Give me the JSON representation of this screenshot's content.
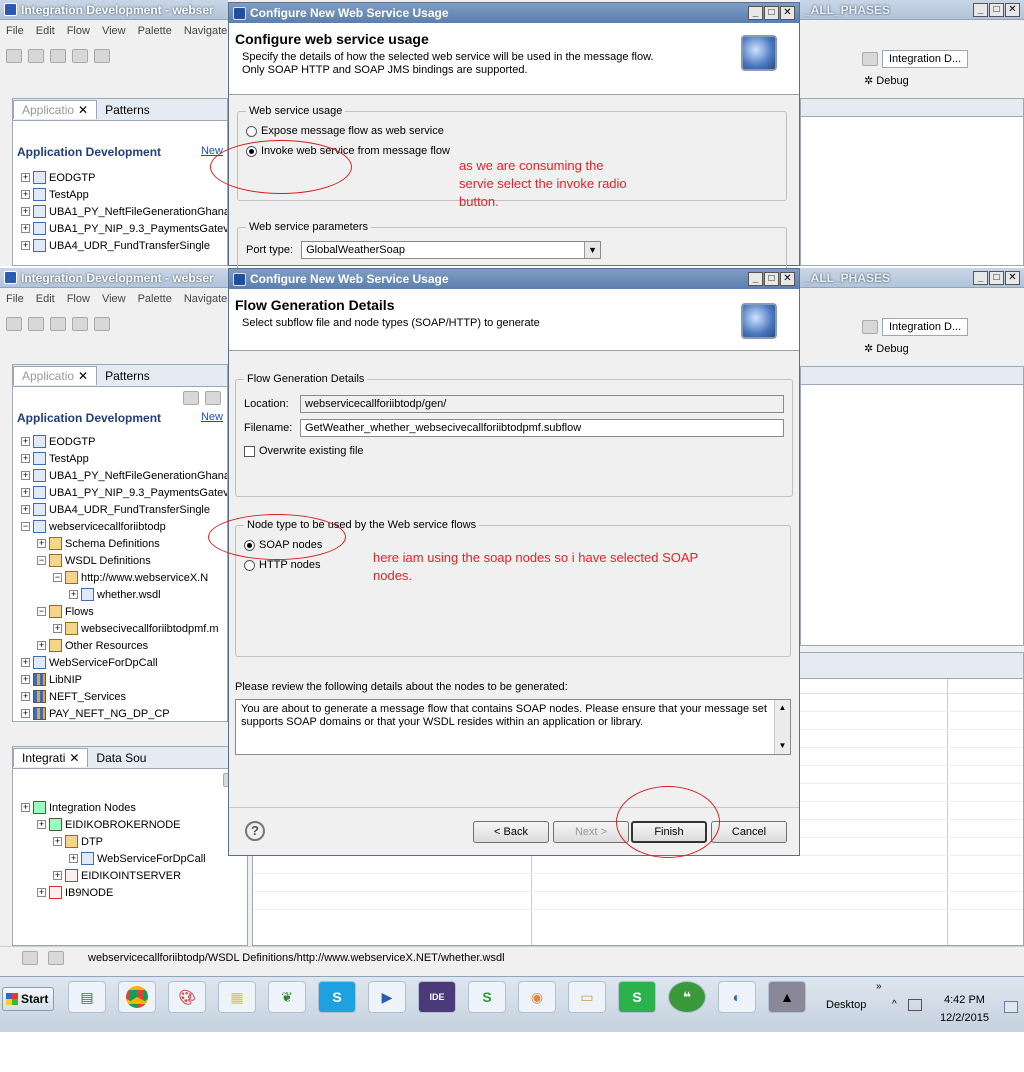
{
  "back_window": {
    "title": "Integration Development - webser",
    "title_right": "_ALL_PHASES",
    "menu": [
      "File",
      "Edit",
      "Flow",
      "View",
      "Palette",
      "Navigate"
    ],
    "tabs": [
      "Applicatio",
      "Patterns"
    ],
    "header": "Application Development",
    "new_link": "New",
    "tree": [
      "EODGTP",
      "TestApp",
      "UBA1_PY_NeftFileGenerationGhana",
      "UBA1_PY_NIP_9.3_PaymentsGatev",
      "UBA4_UDR_FundTransferSingle"
    ],
    "right_panel": {
      "title": "Integration D...",
      "debug": "Debug"
    }
  },
  "front_window": {
    "title": "Integration Development - webser",
    "title_right": "_ALL_PHASES",
    "menu": [
      "File",
      "Edit",
      "Flow",
      "View",
      "Palette",
      "Navigate"
    ],
    "tabs": [
      "Applicatio",
      "Patterns"
    ],
    "header": "Application Development",
    "new_link": "New",
    "tree": [
      {
        "label": "EODGTP",
        "level": 0,
        "icon": "app"
      },
      {
        "label": "TestApp",
        "level": 0,
        "icon": "app"
      },
      {
        "label": "UBA1_PY_NeftFileGenerationGhana",
        "level": 0,
        "icon": "app"
      },
      {
        "label": "UBA1_PY_NIP_9.3_PaymentsGatev",
        "level": 0,
        "icon": "app"
      },
      {
        "label": "UBA4_UDR_FundTransferSingle",
        "level": 0,
        "icon": "app"
      },
      {
        "label": "webservicecallforiibtodp",
        "level": 0,
        "icon": "app",
        "open": true
      },
      {
        "label": "Schema Definitions",
        "level": 1,
        "icon": "res"
      },
      {
        "label": "WSDL Definitions",
        "level": 1,
        "icon": "res",
        "open": true
      },
      {
        "label": "http://www.webserviceX.N",
        "level": 2,
        "icon": "res",
        "open": true
      },
      {
        "label": "whether.wsdl",
        "level": 3,
        "icon": "app"
      },
      {
        "label": "Flows",
        "level": 1,
        "icon": "res",
        "open": true
      },
      {
        "label": "websecivecallforiibtodpmf.m",
        "level": 2,
        "icon": "res"
      },
      {
        "label": "Other Resources",
        "level": 1,
        "icon": "res"
      },
      {
        "label": "WebServiceForDpCall",
        "level": 0,
        "icon": "app"
      },
      {
        "label": "LibNIP",
        "level": 0,
        "icon": "lib"
      },
      {
        "label": "NEFT_Services",
        "level": 0,
        "icon": "lib"
      },
      {
        "label": "PAY_NEFT_NG_DP_CP",
        "level": 0,
        "icon": "lib"
      }
    ],
    "bottom_tabs": [
      "Integrati",
      "Data Sou"
    ],
    "nodes_tree": [
      {
        "label": "Integration Nodes",
        "level": 0,
        "icon": "node"
      },
      {
        "label": "EIDIKOBROKERNODE",
        "level": 1,
        "icon": "node"
      },
      {
        "label": "DTP",
        "level": 2,
        "icon": "res"
      },
      {
        "label": "WebServiceForDpCall",
        "level": 3,
        "icon": "app"
      },
      {
        "label": "EIDIKOINTSERVER",
        "level": 2,
        "icon": "srv"
      },
      {
        "label": "IB9NODE",
        "level": 1,
        "icon": "srv"
      }
    ],
    "right_panel": {
      "title": "Integration D...",
      "debug": "Debug"
    },
    "status_path": "webservicecallforiibtodp/WSDL Definitions/http://www.webserviceX.NET/whether.wsdl"
  },
  "dialog1": {
    "title": "Configure New Web Service Usage",
    "heading": "Configure web service usage",
    "desc1": "Specify the details of how the selected web service will be used in the message flow.",
    "desc2": "Only SOAP HTTP and SOAP JMS bindings are supported.",
    "group_usage": "Web service usage",
    "radio_expose": "Expose message flow as web service",
    "radio_invoke": "Invoke web service from message flow",
    "group_params": "Web service parameters",
    "port_label": "Port type:",
    "port_value": "GlobalWeatherSoap",
    "annotation": "as we are consuming the servie select the invoke radio button."
  },
  "dialog2": {
    "title": "Configure New Web Service Usage",
    "heading": "Flow Generation Details",
    "desc": "Select subflow file and node types (SOAP/HTTP) to generate",
    "group_flow": "Flow Generation Details",
    "location_label": "Location:",
    "location_value": "webservicecallforiibtodp/gen/",
    "filename_label": "Filename:",
    "filename_value": "GetWeather_whether_websecivecallforiibtodpmf.subflow",
    "overwrite_label": "Overwrite existing file",
    "group_node": "Node type to be used by the Web service flows",
    "radio_soap": "SOAP nodes",
    "radio_http": "HTTP nodes",
    "annotation": "here iam using the soap nodes so i have selected SOAP nodes.",
    "review_label": "Please review the following details about the nodes to be generated:",
    "review_text": "You are about to generate a message flow that contains SOAP nodes. Please ensure that your message set supports SOAP domains or that your WSDL resides within an application or library.",
    "buttons": {
      "back": "< Back",
      "next": "Next >",
      "finish": "Finish",
      "cancel": "Cancel"
    }
  },
  "taskbar": {
    "start": "Start",
    "desktop": "Desktop",
    "time": "4:42 PM",
    "date": "12/2/2015"
  }
}
